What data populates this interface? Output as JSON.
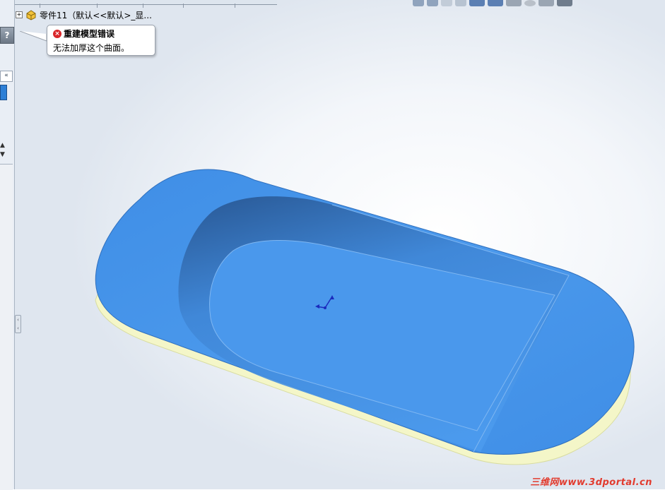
{
  "tree": {
    "part_label": "零件11（默认<<默认>_显..."
  },
  "tooltip": {
    "title": "重建模型错误",
    "message": "无法加厚这个曲面。"
  },
  "left_panel": {
    "help_label": "?",
    "collapse_label": "«"
  },
  "hud_icons": [
    "zoom-to-fit-icon",
    "zoom-area-icon",
    "previous-view-icon",
    "section-view-icon",
    "view-orientation-icon",
    "display-style-icon",
    "hide-show-items-icon",
    "edit-appearance-icon",
    "apply-scene-icon",
    "view-settings-icon"
  ],
  "watermark": "三维网www.3dportal.cn",
  "colors": {
    "model_blue": "#4a97e8",
    "model_edge": "#eef2c8",
    "error_red": "#d9262a"
  }
}
